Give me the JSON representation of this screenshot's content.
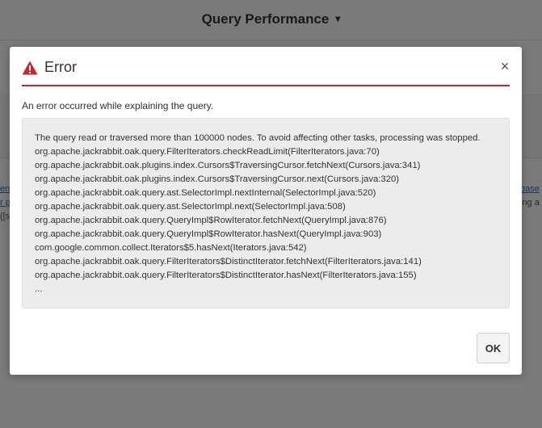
{
  "background": {
    "title": "Query Performance",
    "left_fragments": [
      "enc",
      "r p",
      "([s"
    ],
    "right_fragments": [
      "base",
      "ing a"
    ]
  },
  "dialog": {
    "title": "Error",
    "close_glyph": "×",
    "message": "An error occurred while explaining the query.",
    "details": [
      "The query read or traversed more than 100000 nodes. To avoid affecting other tasks, processing was stopped.",
      "org.apache.jackrabbit.oak.query.FilterIterators.checkReadLimit(FilterIterators.java:70)",
      "org.apache.jackrabbit.oak.plugins.index.Cursors$TraversingCursor.fetchNext(Cursors.java:341)",
      "org.apache.jackrabbit.oak.plugins.index.Cursors$TraversingCursor.next(Cursors.java:320)",
      "org.apache.jackrabbit.oak.query.ast.SelectorImpl.nextInternal(SelectorImpl.java:520)",
      "org.apache.jackrabbit.oak.query.ast.SelectorImpl.next(SelectorImpl.java:508)",
      "org.apache.jackrabbit.oak.query.QueryImpl$RowIterator.fetchNext(QueryImpl.java:876)",
      "org.apache.jackrabbit.oak.query.QueryImpl$RowIterator.hasNext(QueryImpl.java:903)",
      "com.google.common.collect.Iterators$5.hasNext(Iterators.java:542)",
      "org.apache.jackrabbit.oak.query.FilterIterators$DistinctIterator.fetchNext(FilterIterators.java:141)",
      "org.apache.jackrabbit.oak.query.FilterIterators$DistinctIterator.hasNext(FilterIterators.java:155)",
      "..."
    ],
    "ok_label": "OK"
  },
  "colors": {
    "error_red": "#c9252c",
    "overlay": "rgba(0,0,0,0.5)"
  },
  "icons": {
    "alert": "alert-triangle-icon",
    "close": "close-icon",
    "chevron": "chevron-down-icon"
  }
}
